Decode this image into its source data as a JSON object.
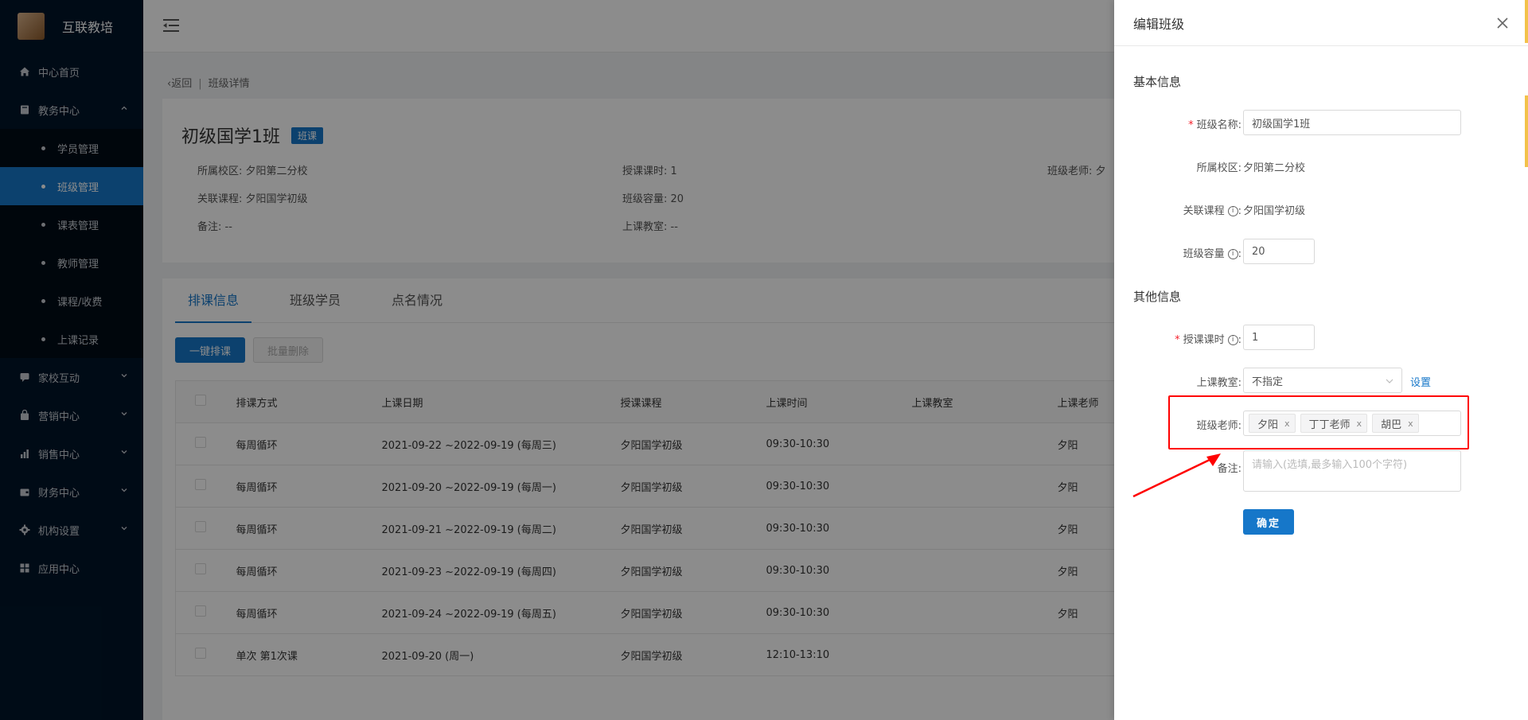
{
  "app": {
    "brand": "互联教培"
  },
  "sidebar": {
    "items": [
      {
        "label": "中心首页",
        "icon": "home-icon"
      },
      {
        "label": "教务中心",
        "icon": "book-icon",
        "expanded": true
      },
      {
        "label": "家校互动",
        "icon": "chat-icon"
      },
      {
        "label": "营销中心",
        "icon": "bag-icon"
      },
      {
        "label": "销售中心",
        "icon": "chart-icon"
      },
      {
        "label": "财务中心",
        "icon": "wallet-icon"
      },
      {
        "label": "机构设置",
        "icon": "gear-icon"
      },
      {
        "label": "应用中心",
        "icon": "grid-icon"
      }
    ],
    "sub_items": [
      "学员管理",
      "班级管理",
      "课表管理",
      "教师管理",
      "课程/收费",
      "上课记录"
    ],
    "active_sub": "班级管理"
  },
  "breadcrumb": {
    "back": "返回",
    "sep": "|",
    "current": "班级详情"
  },
  "class_info": {
    "title": "初级国学1班",
    "type_tag": "班课",
    "campus": "所属校区: 夕阳第二分校",
    "course": "关联课程: 夕阳国学初级",
    "remark": "备注: --",
    "lesson_hours": "授课课时: 1",
    "capacity": "班级容量: 20",
    "classroom": "上课教室: --",
    "teacher": "班级老师: 夕"
  },
  "tabs": [
    "排课信息",
    "班级学员",
    "点名情况"
  ],
  "active_tab": "排课信息",
  "toolbar": {
    "schedule_btn": "一键排课",
    "batch_delete_btn": "批量删除"
  },
  "table": {
    "columns": [
      "排课方式",
      "上课日期",
      "授课课程",
      "上课时间",
      "上课教室",
      "上课老师"
    ],
    "rows": [
      [
        "每周循环",
        "2021-09-22 ~2022-09-19 (每周三)",
        "夕阳国学初级",
        "09:30-10:30",
        "",
        "夕阳"
      ],
      [
        "每周循环",
        "2021-09-20 ~2022-09-19 (每周一)",
        "夕阳国学初级",
        "09:30-10:30",
        "",
        "夕阳"
      ],
      [
        "每周循环",
        "2021-09-21 ~2022-09-19 (每周二)",
        "夕阳国学初级",
        "09:30-10:30",
        "",
        "夕阳"
      ],
      [
        "每周循环",
        "2021-09-23 ~2022-09-19 (每周四)",
        "夕阳国学初级",
        "09:30-10:30",
        "",
        "夕阳"
      ],
      [
        "每周循环",
        "2021-09-24 ~2022-09-19 (每周五)",
        "夕阳国学初级",
        "09:30-10:30",
        "",
        "夕阳"
      ],
      [
        "单次 第1次课",
        "2021-09-20 (周一)",
        "夕阳国学初级",
        "12:10-13:10",
        "",
        ""
      ]
    ]
  },
  "drawer": {
    "title": "编辑班级",
    "section_basic": "基本信息",
    "section_other": "其他信息",
    "class_name_label": "班级名称:",
    "class_name_value": "初级国学1班",
    "campus_label": "所属校区:",
    "campus_value": "夕阳第二分校",
    "course_label": "关联课程",
    "course_value": "夕阳国学初级",
    "capacity_label": "班级容量",
    "capacity_value": "20",
    "hours_label": "授课课时",
    "hours_value": "1",
    "classroom_label": "上课教室:",
    "classroom_value": "不指定",
    "classroom_link": "设置",
    "teacher_label": "班级老师:",
    "teachers": [
      "夕阳",
      "丁丁老师",
      "胡巴"
    ],
    "remark_label": "备注:",
    "remark_placeholder": "请输入(选填,最多输入100个字符)",
    "confirm_btn": "确定",
    "info_glyph": "i",
    "colon": ":",
    "chip_remove": "x"
  },
  "colors": {
    "accent": "#1677c9",
    "sidebar_bg": "#001529",
    "highlight": "#ff0000"
  }
}
